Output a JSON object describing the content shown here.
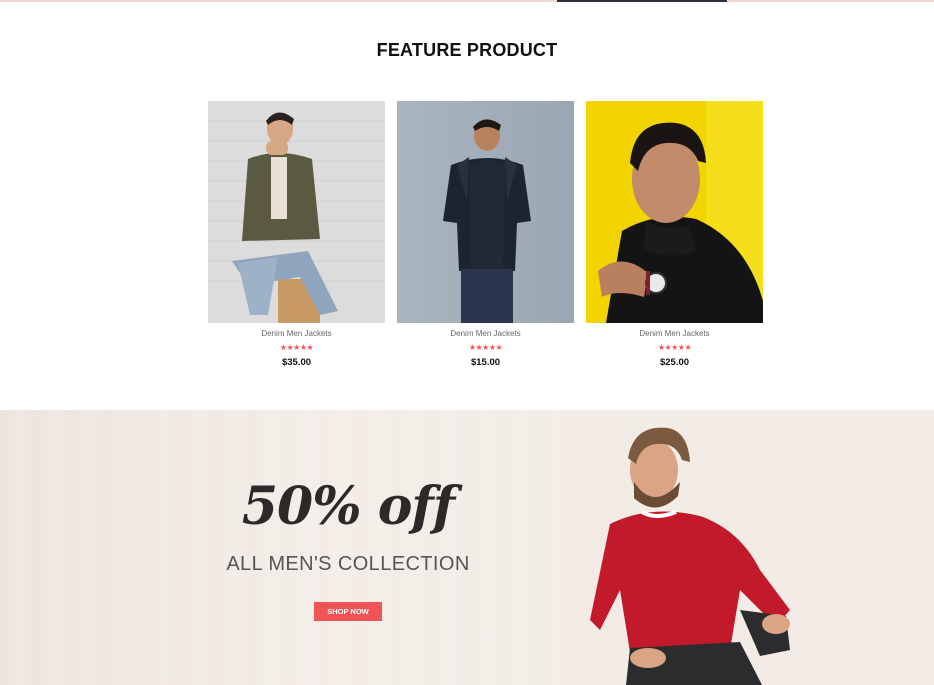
{
  "feature": {
    "title": "FEATURE PRODUCT",
    "products": [
      {
        "name": "Denim Men Jackets",
        "stars": "★★★★★",
        "price": "$35.00",
        "image": "man-green-jacket-sitting"
      },
      {
        "name": "Denim Men Jackets",
        "stars": "★★★★★",
        "price": "$15.00",
        "image": "man-dark-shirt-standing"
      },
      {
        "name": "Denim Men Jackets",
        "stars": "★★★★★",
        "price": "$25.00",
        "image": "man-black-turtleneck-yellow-bg"
      }
    ]
  },
  "promo": {
    "headline": "50% off",
    "subtitle": "ALL MEN'S COLLECTION",
    "button_label": "SHOP NOW",
    "image": "man-red-sweater-crouching"
  },
  "colors": {
    "accent": "#f05454",
    "promo_bg": "#f2ebe5",
    "title": "#111111"
  }
}
